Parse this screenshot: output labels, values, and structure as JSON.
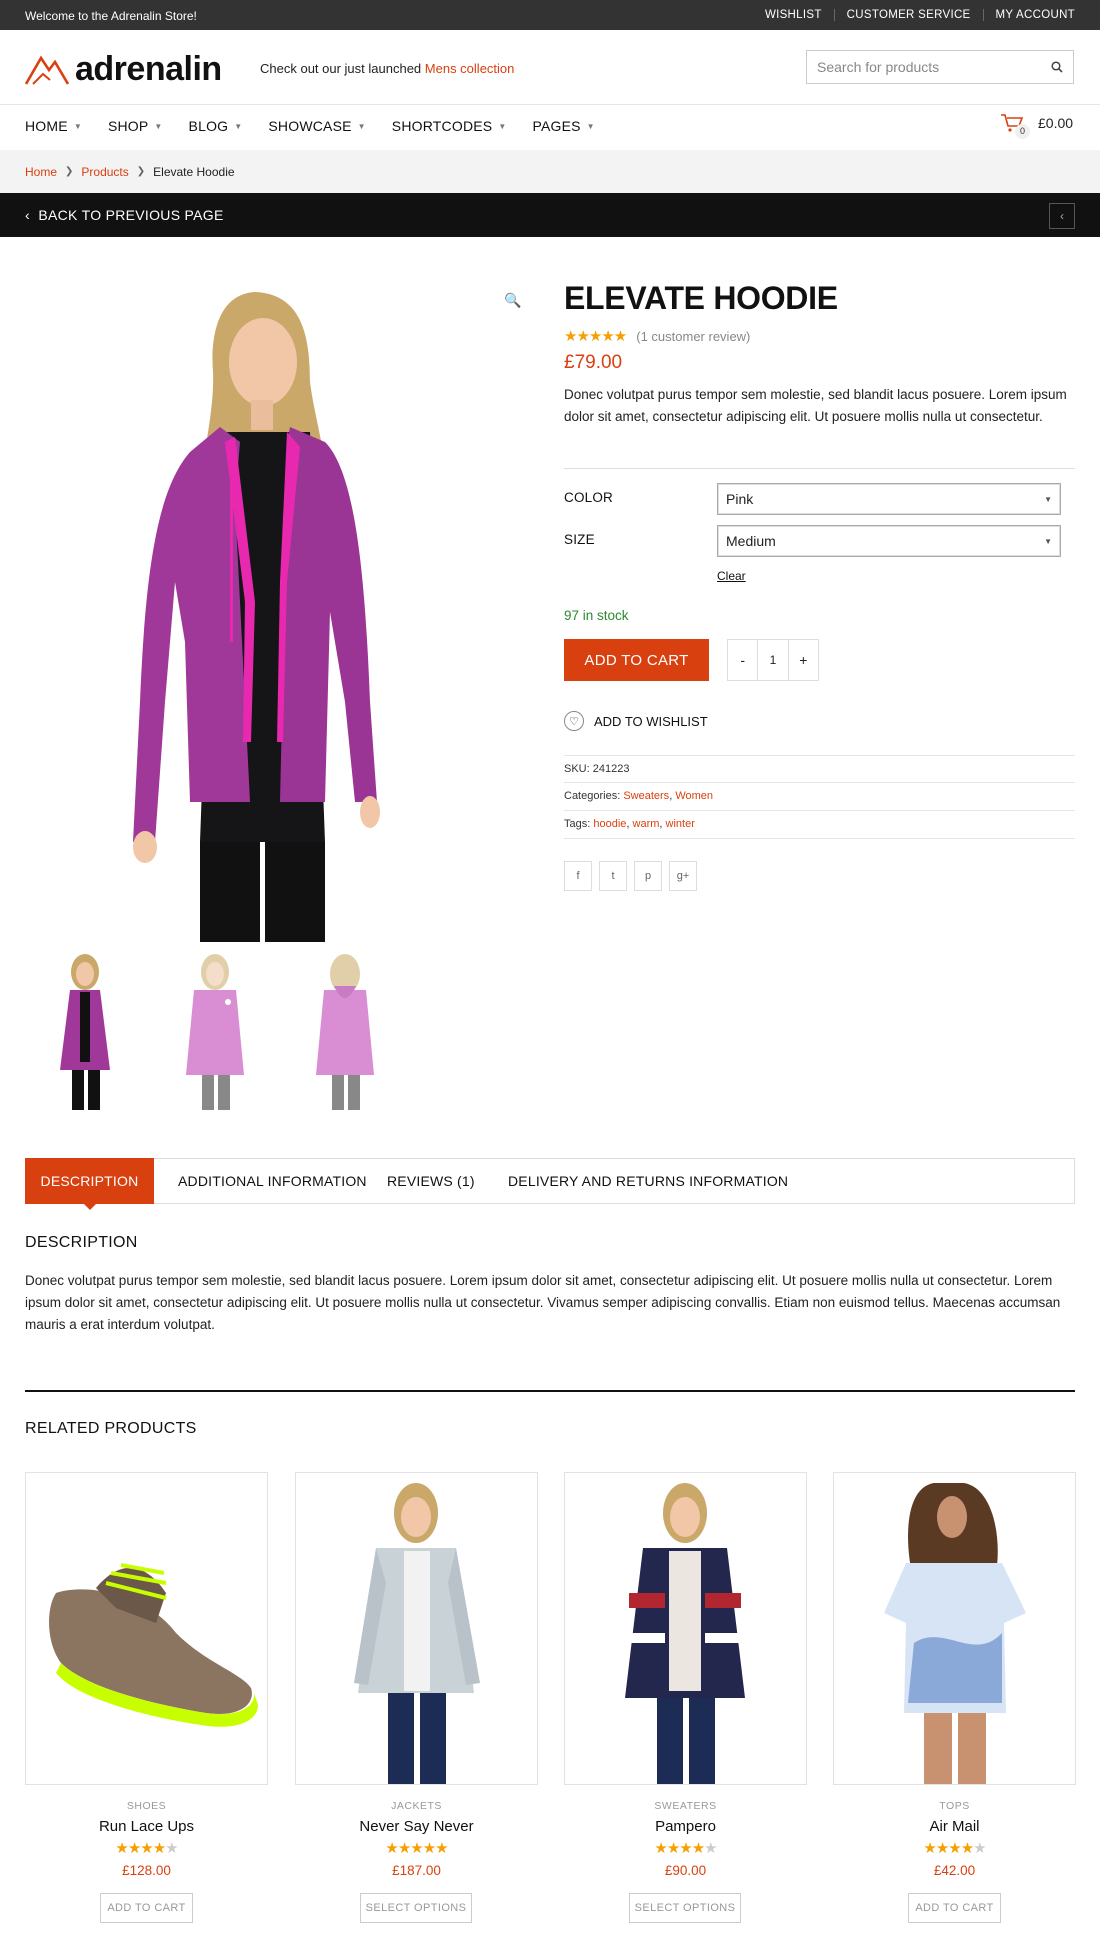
{
  "topbar": {
    "welcome": "Welcome to the Adrenalin Store!",
    "links": [
      "WISHLIST",
      "CUSTOMER SERVICE",
      "MY ACCOUNT"
    ]
  },
  "header": {
    "logo_text": "adrenalin",
    "promo_prefix": "Check out our just launched",
    "promo_link": "Mens collection",
    "search_placeholder": "Search for products"
  },
  "nav": {
    "items": [
      "HOME",
      "SHOP",
      "BLOG",
      "SHOWCASE",
      "SHORTCODES",
      "PAGES"
    ],
    "cart_count": "0",
    "cart_total": "£0.00"
  },
  "breadcrumb": [
    "Home",
    "Products",
    "Elevate Hoodie"
  ],
  "back_label": "BACK TO PREVIOUS PAGE",
  "product": {
    "title": "ELEVATE HOODIE",
    "rating": 5,
    "review_text": "(1 customer review)",
    "price": "£79.00",
    "short_description": "Donec volutpat purus tempor sem molestie, sed blandit lacus posuere. Lorem ipsum dolor sit amet, consectetur adipiscing elit. Ut posuere mollis nulla ut consectetur.",
    "color_label": "COLOR",
    "color_value": "Pink",
    "size_label": "SIZE",
    "size_value": "Medium",
    "clear_label": "Clear",
    "stock": "97 in stock",
    "add_to_cart": "ADD TO CART",
    "qty_minus": "-",
    "qty": "1",
    "qty_plus": "+",
    "wishlist": "ADD TO WISHLIST",
    "sku_label": "SKU:",
    "sku": "241223",
    "categories_label": "Categories:",
    "categories": [
      "Sweaters",
      "Women"
    ],
    "tags_label": "Tags:",
    "tags": [
      "hoodie",
      "warm",
      "winter"
    ],
    "social_icons": [
      "f",
      "t",
      "p",
      "g+"
    ]
  },
  "tabs": [
    "DESCRIPTION",
    "ADDITIONAL INFORMATION",
    "REVIEWS (1)",
    "DELIVERY AND RETURNS INFORMATION"
  ],
  "description": {
    "heading": "DESCRIPTION",
    "text": "Donec volutpat purus tempor sem molestie, sed blandit lacus posuere. Lorem ipsum dolor sit amet, consectetur adipiscing elit. Ut posuere mollis nulla ut consectetur. Lorem ipsum dolor sit amet, consectetur adipiscing elit. Ut posuere mollis nulla ut consectetur. Vivamus semper adipiscing convallis. Etiam non euismod tellus. Maecenas accumsan mauris a erat interdum volutpat."
  },
  "related": {
    "heading": "RELATED PRODUCTS",
    "products": [
      {
        "category": "SHOES",
        "name": "Run Lace Ups",
        "rating": 4.5,
        "price": "£128.00",
        "button": "ADD TO CART"
      },
      {
        "category": "JACKETS",
        "name": "Never Say Never",
        "rating": 5,
        "price": "£187.00",
        "button": "SELECT OPTIONS"
      },
      {
        "category": "SWEATERS",
        "name": "Pampero",
        "rating": 4.5,
        "price": "£90.00",
        "button": "SELECT OPTIONS"
      },
      {
        "category": "TOPS",
        "name": "Air Mail",
        "rating": 4.5,
        "price": "£42.00",
        "button": "ADD TO CART"
      }
    ]
  },
  "colors": {
    "accent": "#d94010",
    "topbar": "#333333",
    "backbar": "#111111",
    "stock": "#2d8a2d",
    "star": "#f5a000"
  }
}
